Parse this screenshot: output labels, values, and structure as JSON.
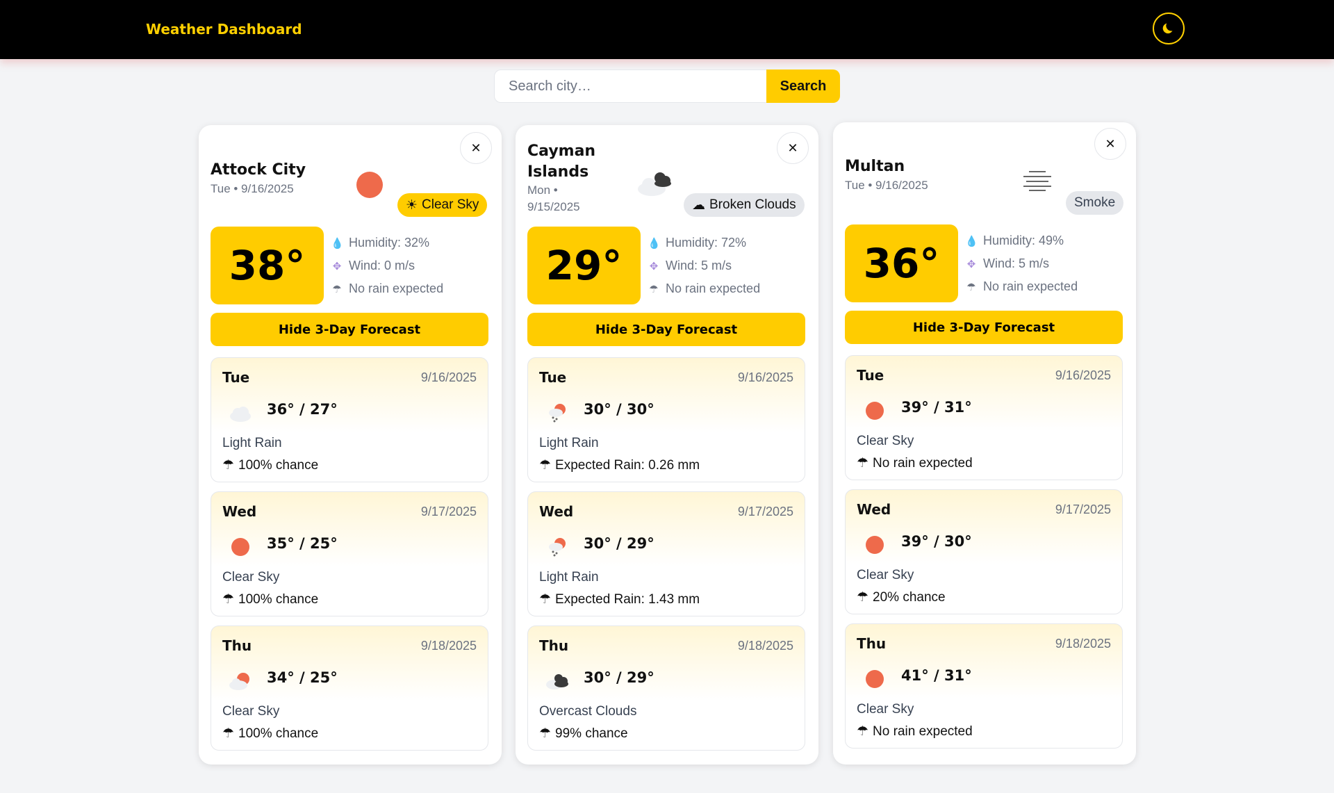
{
  "header": {
    "title": "Weather Dashboard",
    "theme_icon": "moon-icon"
  },
  "search": {
    "placeholder": "Search city…",
    "button_label": "Search"
  },
  "cities": [
    {
      "name": "Attock City",
      "date": "Tue • 9/16/2025",
      "condition": "Clear Sky",
      "condition_icon": "sun-icon",
      "temp": "38°",
      "humidity": "Humidity: 32%",
      "wind": "Wind: 0 m/s",
      "rain": "No rain expected",
      "forecast_button": "Hide 3-Day Forecast",
      "forecast": [
        {
          "day": "Tue",
          "date": "9/16/2025",
          "temps": "36° / 27°",
          "desc": "Light Rain",
          "rain": "100% chance",
          "icon": "cloud-icon"
        },
        {
          "day": "Wed",
          "date": "9/17/2025",
          "temps": "35° / 25°",
          "desc": "Clear Sky",
          "rain": "100% chance",
          "icon": "sun-icon"
        },
        {
          "day": "Thu",
          "date": "9/18/2025",
          "temps": "34° / 25°",
          "desc": "Clear Sky",
          "rain": "100% chance",
          "icon": "sun-cloud-icon"
        }
      ]
    },
    {
      "name": "Cayman Islands",
      "date": "Mon • 9/15/2025",
      "condition": "Broken Clouds",
      "condition_icon": "cloud-icon",
      "temp": "29°",
      "humidity": "Humidity: 72%",
      "wind": "Wind: 5 m/s",
      "rain": "No rain expected",
      "forecast_button": "Hide 3-Day Forecast",
      "forecast": [
        {
          "day": "Tue",
          "date": "9/16/2025",
          "temps": "30° / 30°",
          "desc": "Light Rain",
          "rain": "Expected Rain: 0.26 mm",
          "icon": "sun-rain-icon"
        },
        {
          "day": "Wed",
          "date": "9/17/2025",
          "temps": "30° / 29°",
          "desc": "Light Rain",
          "rain": "Expected Rain: 1.43 mm",
          "icon": "sun-rain-icon"
        },
        {
          "day": "Thu",
          "date": "9/18/2025",
          "temps": "30° / 29°",
          "desc": "Overcast Clouds",
          "rain": "99% chance",
          "icon": "dark-clouds-icon"
        }
      ]
    },
    {
      "name": "Multan",
      "date": "Tue • 9/16/2025",
      "condition": "Smoke",
      "condition_icon": "",
      "temp": "36°",
      "humidity": "Humidity: 49%",
      "wind": "Wind: 5 m/s",
      "rain": "No rain expected",
      "forecast_button": "Hide 3-Day Forecast",
      "forecast": [
        {
          "day": "Tue",
          "date": "9/16/2025",
          "temps": "39° / 31°",
          "desc": "Clear Sky",
          "rain": "No rain expected",
          "icon": "sun-icon"
        },
        {
          "day": "Wed",
          "date": "9/17/2025",
          "temps": "39° / 30°",
          "desc": "Clear Sky",
          "rain": "20% chance",
          "icon": "sun-icon"
        },
        {
          "day": "Thu",
          "date": "9/18/2025",
          "temps": "41° / 31°",
          "desc": "Clear Sky",
          "rain": "No rain expected",
          "icon": "sun-icon"
        }
      ]
    }
  ],
  "colors": {
    "accent": "#ffcc00",
    "header_bg": "#000000",
    "sun": "#ee6a4b"
  }
}
